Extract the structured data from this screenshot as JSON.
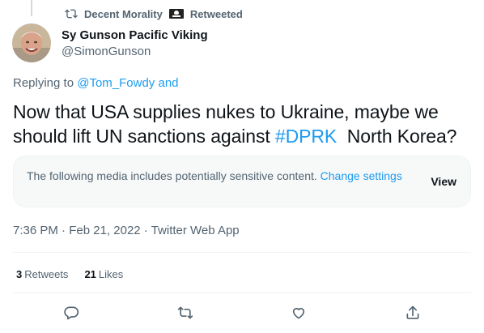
{
  "retweet_context": {
    "retweeter": "Decent Morality",
    "label": "Retweeted"
  },
  "author": {
    "name": "Sy Gunson Pacific Viking",
    "handle": "@SimonGunson"
  },
  "reply": {
    "prefix": "Replying to",
    "mention": "@Tom_Fowdy",
    "suffix": "and"
  },
  "tweet": {
    "text_before": "Now that USA supplies nukes to Ukraine, maybe we should lift UN sanctions against ",
    "hashtag": "#DPRK",
    "text_after": "  North Korea?"
  },
  "sensitive_notice": {
    "text": "The following media includes potentially sensitive content.",
    "link": "Change settings",
    "view_label": "View"
  },
  "meta": {
    "time": "7:36 PM",
    "separator": "·",
    "date": "Feb 21, 2022",
    "source": "Twitter Web App"
  },
  "stats": {
    "retweets_count": "3",
    "retweets_label": "Retweets",
    "likes_count": "21",
    "likes_label": "Likes"
  },
  "actions": [
    "reply-icon",
    "retweet-icon",
    "like-icon",
    "share-icon"
  ],
  "colors": {
    "accent": "#1d9bf0",
    "secondary_text": "#536471",
    "primary_text": "#0f1419",
    "divider": "#eff3f4"
  }
}
